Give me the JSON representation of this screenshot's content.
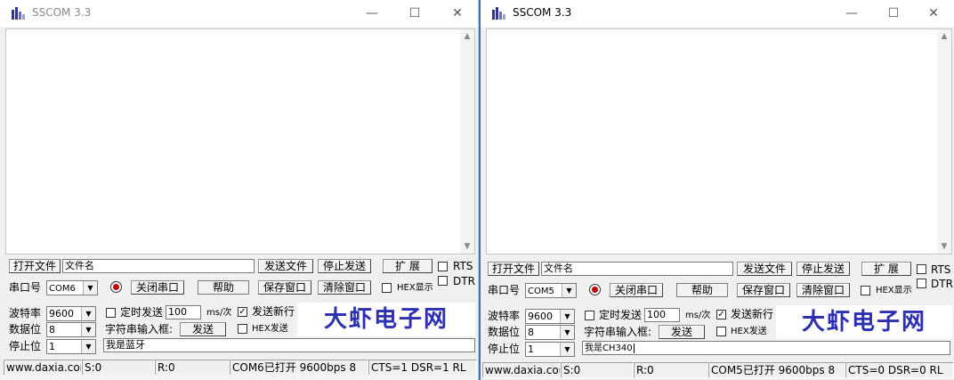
{
  "windows": [
    {
      "title": "SSCOM 3.3",
      "open_file_label": "打开文件",
      "file_name_value": "文件名",
      "send_file_label": "发送文件",
      "stop_send_label": "停止发送",
      "expand_label": "扩 展",
      "rts_label": "RTS",
      "dtr_label": "DTR",
      "port_label": "串口号",
      "port_value": "COM6",
      "close_port_label": "关闭串口",
      "help_label": "帮助",
      "save_window_label": "保存窗口",
      "clear_window_label": "清除窗口",
      "hex_display_label": "HEX显示",
      "baud_label": "波特率",
      "baud_value": "9600",
      "timed_send_label": "定时发送",
      "interval_value": "100",
      "interval_unit": "ms/次",
      "send_newline_label": "发送新行",
      "data_bits_label": "数据位",
      "data_bits_value": "8",
      "string_input_label": "字符串输入框:",
      "send_label": "发送",
      "hex_send_label": "HEX发送",
      "stop_bits_label": "停止位",
      "stop_bits_value": "1",
      "send_text_value": "我是蓝牙",
      "banner_text": "大虾电子网",
      "status": {
        "website": "www.daxia.cor",
        "sent": "S:0",
        "received": "R:0",
        "port_state": "COM6已打开  9600bps  8",
        "lines": "CTS=1 DSR=1 RL"
      }
    },
    {
      "title": "SSCOM 3.3",
      "open_file_label": "打开文件",
      "file_name_value": "文件名",
      "send_file_label": "发送文件",
      "stop_send_label": "停止发送",
      "expand_label": "扩 展",
      "rts_label": "RTS",
      "dtr_label": "DTR",
      "port_label": "串口号",
      "port_value": "COM5",
      "close_port_label": "关闭串口",
      "help_label": "帮助",
      "save_window_label": "保存窗口",
      "clear_window_label": "清除窗口",
      "hex_display_label": "HEX显示",
      "baud_label": "波特率",
      "baud_value": "9600",
      "timed_send_label": "定时发送",
      "interval_value": "100",
      "interval_unit": "ms/次",
      "send_newline_label": "发送新行",
      "data_bits_label": "数据位",
      "data_bits_value": "8",
      "string_input_label": "字符串输入框:",
      "send_label": "发送",
      "hex_send_label": "HEX发送",
      "stop_bits_label": "停止位",
      "stop_bits_value": "1",
      "send_text_value": "我是CH340",
      "banner_text": "大虾电子网",
      "status": {
        "website": "www.daxia.cor",
        "sent": "S:0",
        "received": "R:0",
        "port_state": "COM5已打开  9600bps  8",
        "lines": "CTS=0 DSR=0 RL"
      }
    }
  ],
  "icons": {
    "app": "sscom-app-icon",
    "minimize": "minimize-icon",
    "maximize": "maximize-icon",
    "close": "close-icon"
  },
  "colors": {
    "banner_text": "#2e30b3",
    "port_indicator": "#c00000",
    "active_border": "#3d6fb5"
  }
}
